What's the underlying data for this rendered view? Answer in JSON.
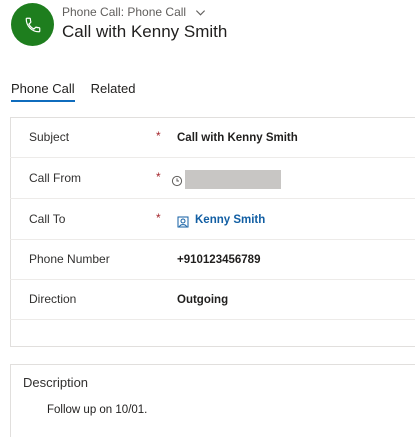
{
  "header": {
    "entity_type": "Phone Call: Phone Call",
    "title": "Call with Kenny Smith",
    "avatar_icon": "phone-icon",
    "avatar_color": "#1e7e1e"
  },
  "tabs": [
    {
      "label": "Phone Call",
      "active": true
    },
    {
      "label": "Related",
      "active": false
    }
  ],
  "form": {
    "subject": {
      "label": "Subject",
      "required": "*",
      "value": "Call with Kenny Smith"
    },
    "call_from": {
      "label": "Call From",
      "required": "*"
    },
    "call_to": {
      "label": "Call To",
      "required": "*",
      "value": "Kenny Smith"
    },
    "phone_number": {
      "label": "Phone Number",
      "value": "+910123456789"
    },
    "direction": {
      "label": "Direction",
      "value": "Outgoing"
    }
  },
  "description": {
    "title": "Description",
    "value": "Follow up on 10/01."
  },
  "colors": {
    "accent": "#0f6cbd",
    "link": "#115ea3",
    "required": "#a4262c"
  }
}
